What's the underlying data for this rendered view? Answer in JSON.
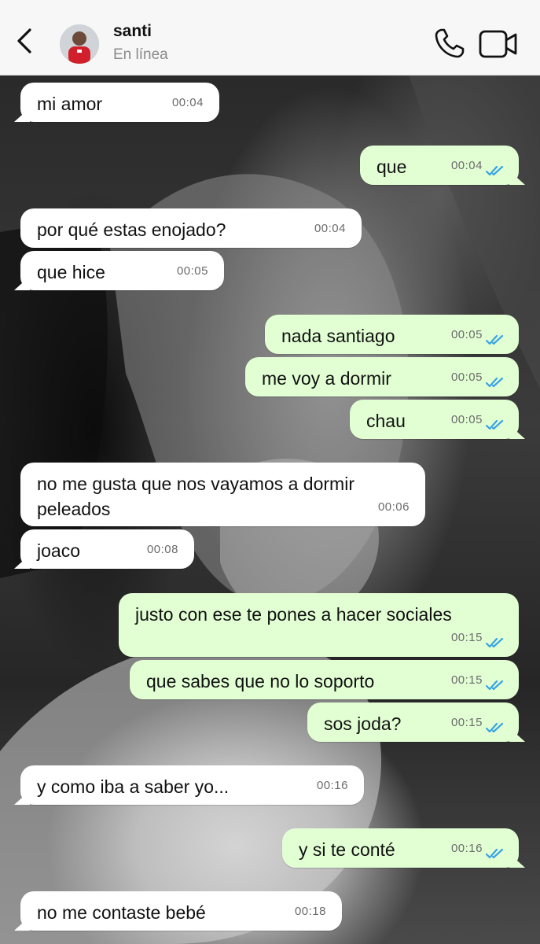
{
  "header": {
    "contact_name": "santi",
    "status": "En línea"
  },
  "messages": [
    {
      "dir": "in",
      "text": "mi amor",
      "time": "00:04"
    },
    {
      "dir": "out",
      "text": "que",
      "time": "00:04",
      "read": true
    },
    {
      "dir": "in",
      "text": "por qué estas enojado?",
      "time": "00:04"
    },
    {
      "dir": "in",
      "text": "que hice",
      "time": "00:05"
    },
    {
      "dir": "out",
      "text": "nada santiago",
      "time": "00:05",
      "read": true
    },
    {
      "dir": "out",
      "text": "me voy a dormir",
      "time": "00:05",
      "read": true
    },
    {
      "dir": "out",
      "text": "chau",
      "time": "00:05",
      "read": true
    },
    {
      "dir": "in",
      "text": "no me gusta que nos vayamos a dormir",
      "text2": "peleados",
      "time": "00:06"
    },
    {
      "dir": "in",
      "text": "joaco",
      "time": "00:08"
    },
    {
      "dir": "out",
      "text": "justo con ese te pones a hacer sociales",
      "time": "00:15",
      "read": true
    },
    {
      "dir": "out",
      "text": "que sabes que no lo soporto",
      "time": "00:15",
      "read": true
    },
    {
      "dir": "out",
      "text": "sos joda?",
      "time": "00:15",
      "read": true
    },
    {
      "dir": "in",
      "text": "y como iba a saber yo...",
      "time": "00:16"
    },
    {
      "dir": "out",
      "text": "y si te conté",
      "time": "00:16",
      "read": true
    },
    {
      "dir": "in",
      "text": "no me contaste bebé",
      "time": "00:18"
    }
  ],
  "colors": {
    "incoming_bubble": "#ffffff",
    "outgoing_bubble": "#e2ffd4",
    "read_tick": "#3aa3e3",
    "header_bg": "#f7f7f7"
  },
  "icons": [
    "back-chevron-icon",
    "contact-avatar",
    "phone-icon",
    "video-camera-icon",
    "double-check-icon"
  ]
}
